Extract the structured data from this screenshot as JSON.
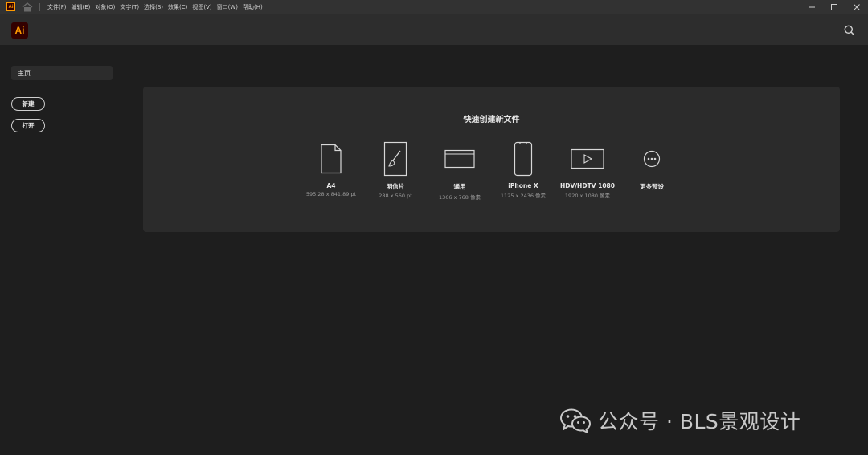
{
  "menubar": {
    "logo_text": "Ai",
    "items": [
      "文件(F)",
      "编辑(E)",
      "对象(O)",
      "文字(T)",
      "选择(S)",
      "效果(C)",
      "视图(V)",
      "窗口(W)",
      "帮助(H)"
    ]
  },
  "header": {
    "logo_text": "Ai",
    "search_icon": "search-icon"
  },
  "sidebar": {
    "home_label": "主页",
    "new_label": "新建",
    "open_label": "打开"
  },
  "quick_create": {
    "title": "快速创建新文件",
    "presets": [
      {
        "name": "A4",
        "size": "595.28 x 841.89 pt",
        "icon": "document-icon"
      },
      {
        "name": "明信片",
        "size": "288 x 560 pt",
        "icon": "brush-card-icon"
      },
      {
        "name": "通用",
        "size": "1366 x 768 像素",
        "icon": "web-screen-icon"
      },
      {
        "name": "iPhone X",
        "size": "1125 x 2436 像素",
        "icon": "phone-icon"
      },
      {
        "name": "HDV/HDTV 1080",
        "size": "1920 x 1080 像素",
        "icon": "video-play-icon"
      },
      {
        "name": "更多预设",
        "size": "",
        "icon": "more-icon"
      }
    ]
  },
  "watermark": {
    "text": "公众号 · BLS景观设计",
    "icon": "wechat-icon"
  },
  "colors": {
    "background": "#1e1e1e",
    "menubar": "#323232",
    "header": "#2d2d2d",
    "panel": "#2b2b2b",
    "ai_orange": "#ff9a00",
    "ai_dark": "#330000"
  }
}
